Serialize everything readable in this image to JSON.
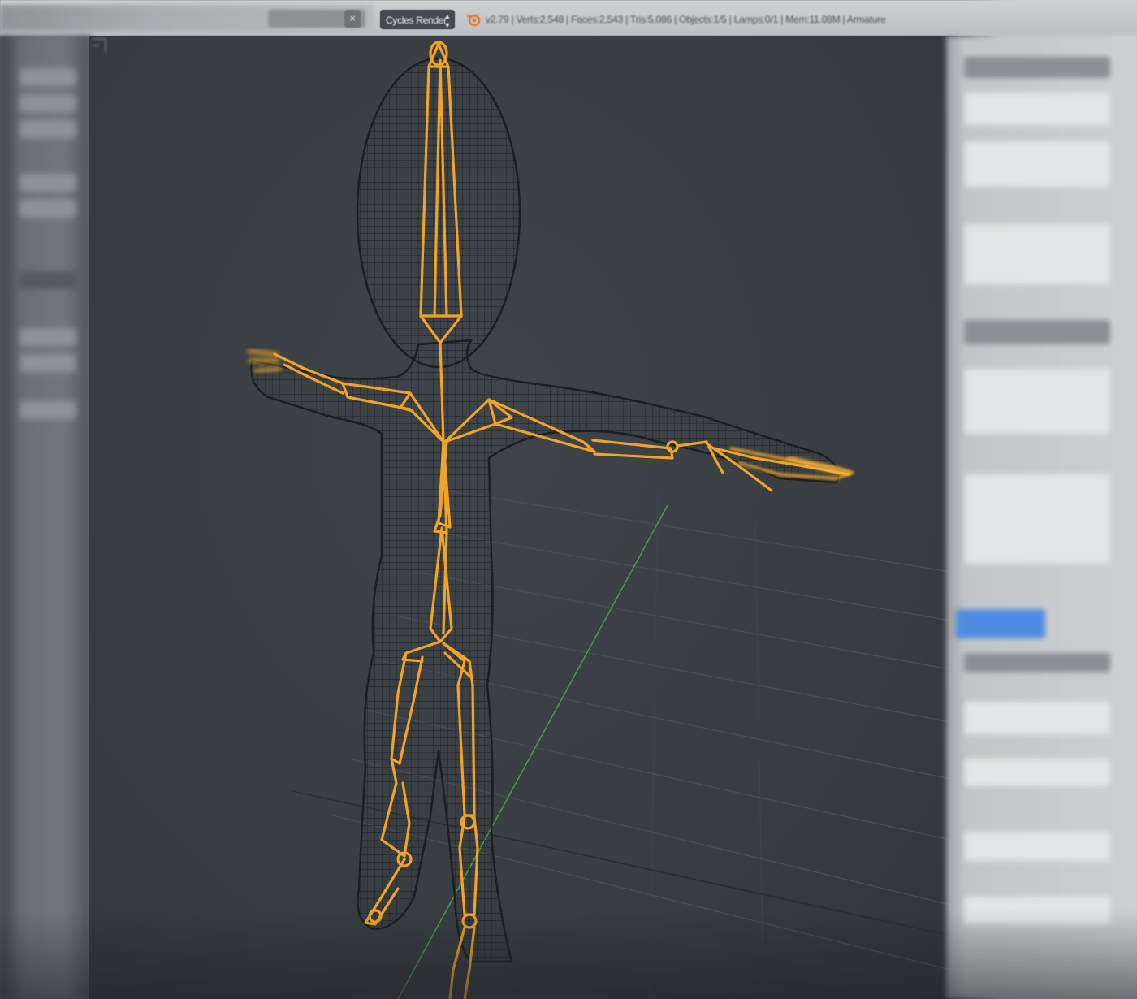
{
  "header": {
    "scene_close": "×",
    "render_engine": "Cycles Render",
    "render_engine_arrows": "▲▼",
    "stats": "v2.79 | Verts:2,548 | Faces:2,543 | Tris:5,086 | Objects:1/5 | Lamps:0/1 | Mem:11.08M | Armature"
  },
  "viewport": {
    "mode": "wireframe",
    "selected_object": "armature",
    "colors": {
      "background": "#3a3f44",
      "mesh_wire": "#1c2023",
      "bone_selected": "#f0a326",
      "grid_line": "#4a5157",
      "axis_y": "#4aa84a"
    }
  },
  "icons": {
    "logo": "blender-logo-icon",
    "view_widget": "view-corner-icon"
  },
  "colors": {
    "header_bg": "#c6c9cb",
    "engine_select_bg": "#444a50",
    "accent": "#4f8be0"
  }
}
